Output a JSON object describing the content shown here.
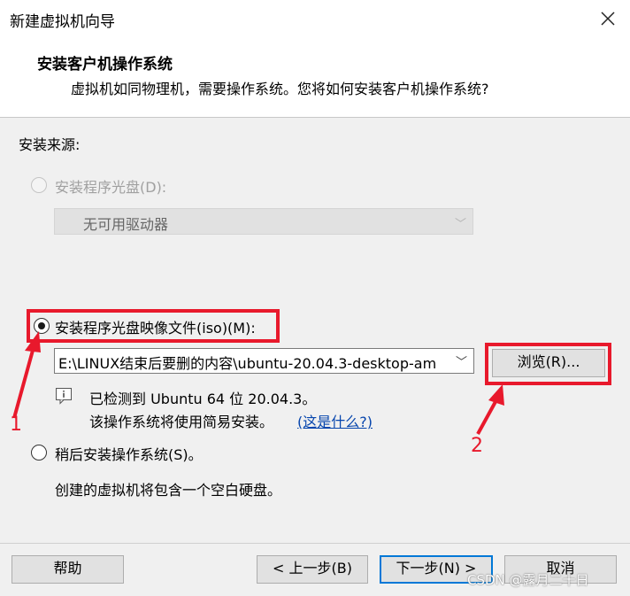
{
  "window": {
    "title": "新建虚拟机向导",
    "close_glyph": "✕"
  },
  "header": {
    "heading": "安装客户机操作系统",
    "subheading": "虚拟机如同物理机，需要操作系统。您将如何安装客户机操作系统?"
  },
  "install_source": {
    "label": "安装来源:",
    "disc_option": {
      "label": "安装程序光盘(D):",
      "selected": false,
      "enabled": false,
      "drive_select_value": "无可用驱动器"
    },
    "iso_option": {
      "label": "安装程序光盘映像文件(iso)(M):",
      "selected": true,
      "path_value": "E:\\LINUX结束后要删的内容\\ubuntu-20.04.3-desktop-am",
      "browse_label": "浏览(R)...",
      "detected_text": "已检测到 Ubuntu 64 位 20.04.3。",
      "easy_install_text": "该操作系统将使用简易安装。",
      "what_is_this_link": "(这是什么?)"
    },
    "later_option": {
      "label": "稍后安装操作系统(S)。",
      "selected": false,
      "description": "创建的虚拟机将包含一个空白硬盘。"
    }
  },
  "footer": {
    "help_label": "帮助",
    "back_label": "< 上一步(B)",
    "next_label": "下一步(N) >",
    "cancel_label": "取消"
  },
  "annotations": {
    "marker_1": "1",
    "marker_2": "2",
    "color": "#e8192c"
  },
  "watermark": "CSDN @露月二十日",
  "colors": {
    "accent": "#0078d7",
    "link": "#0645ad",
    "highlight": "#e8192c"
  }
}
